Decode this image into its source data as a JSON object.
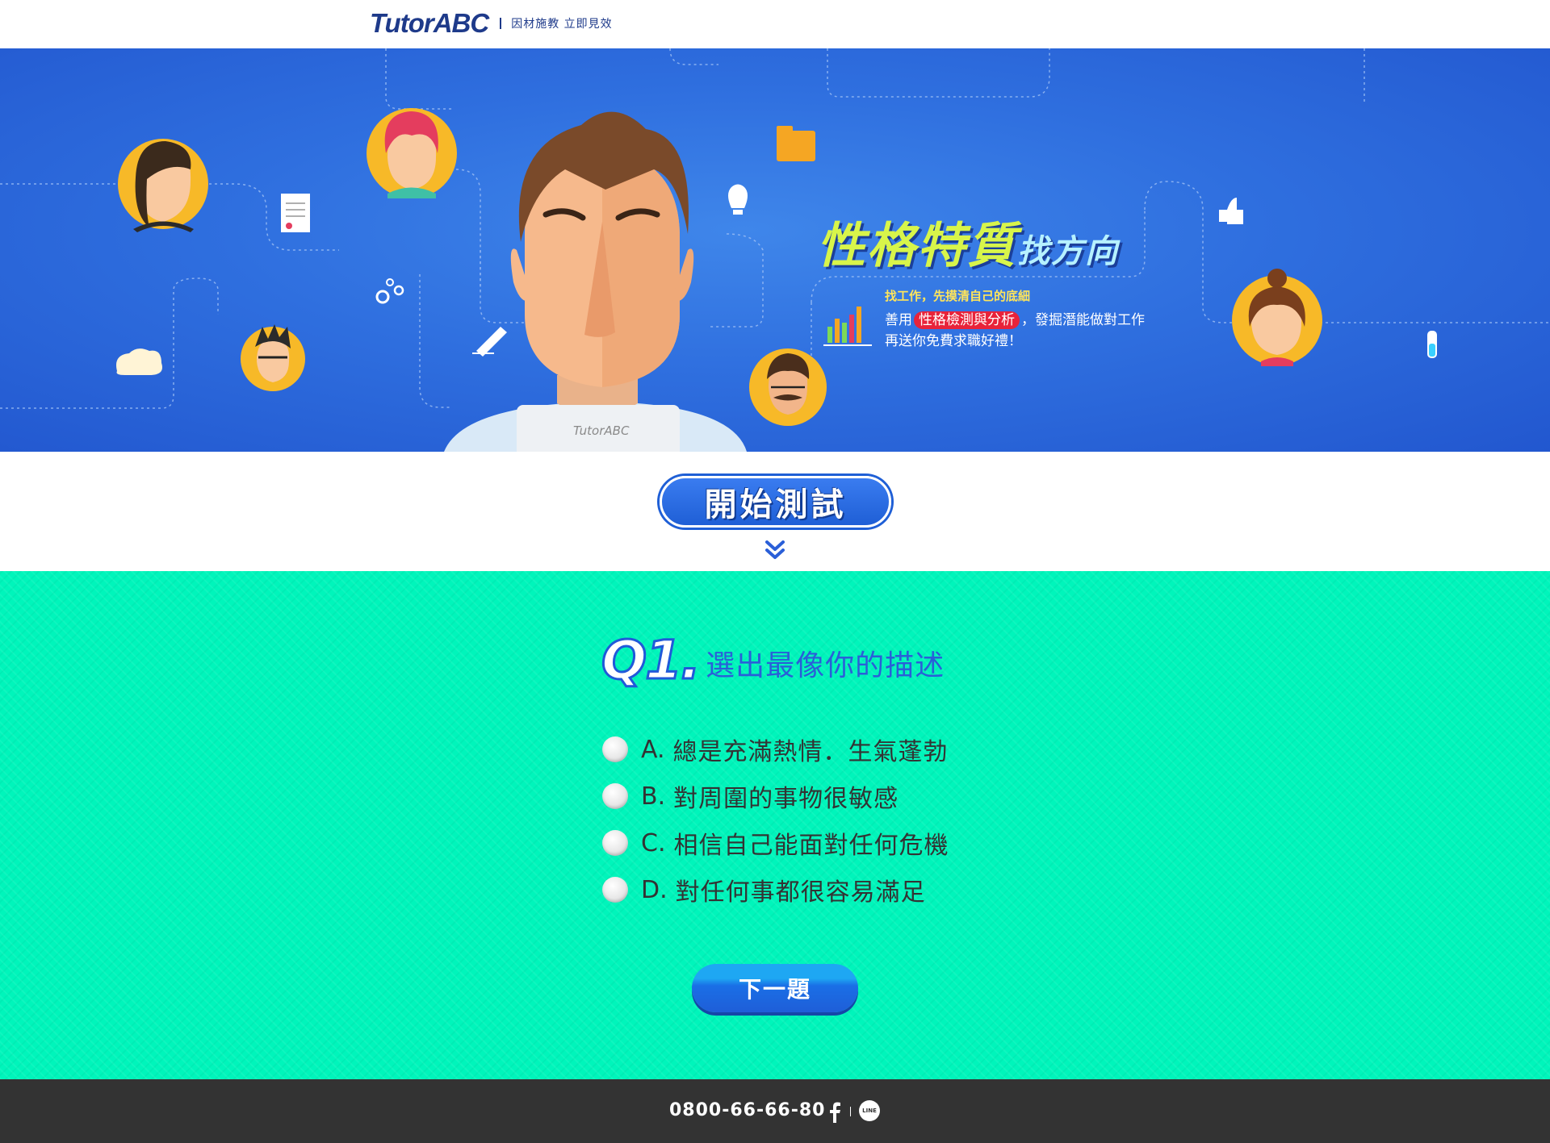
{
  "header": {
    "logo_text": "TutorABC",
    "slogan": "因材施教 立即見效"
  },
  "hero": {
    "title_main": "性格特質",
    "title_small": "找方向",
    "line1": "找工作，先摸清自己的底細",
    "line2_pre": "善用",
    "line2_highlight": "性格檢測與分析",
    "line2_post": "，發掘潛能做對工作",
    "line3": "再送你免費求職好禮！",
    "laptop_brand": "TutorABC"
  },
  "start": {
    "button_label": "開始測試",
    "chevron_icon": "double-chevron-down-icon"
  },
  "quiz": {
    "question_number": "Q1.",
    "question_text": "選出最像你的描述",
    "options": [
      {
        "letter": "A.",
        "text": "總是充滿熱情．生氣蓬勃"
      },
      {
        "letter": "B.",
        "text": "對周圍的事物很敏感"
      },
      {
        "letter": "C.",
        "text": "相信自己能面對任何危機"
      },
      {
        "letter": "D.",
        "text": "對任何事都很容易滿足"
      }
    ],
    "next_button": "下一題"
  },
  "footer": {
    "phone": "0800-66-66-80",
    "facebook_icon": "facebook-icon",
    "line_icon": "line-icon",
    "line_icon_text": "LINE"
  },
  "colors": {
    "brand_blue": "#1e3a8a",
    "hero_blue": "#2f6fdf",
    "quiz_green": "#00f5bb",
    "footer_dark": "#333333",
    "highlight_red": "#e8233a"
  }
}
